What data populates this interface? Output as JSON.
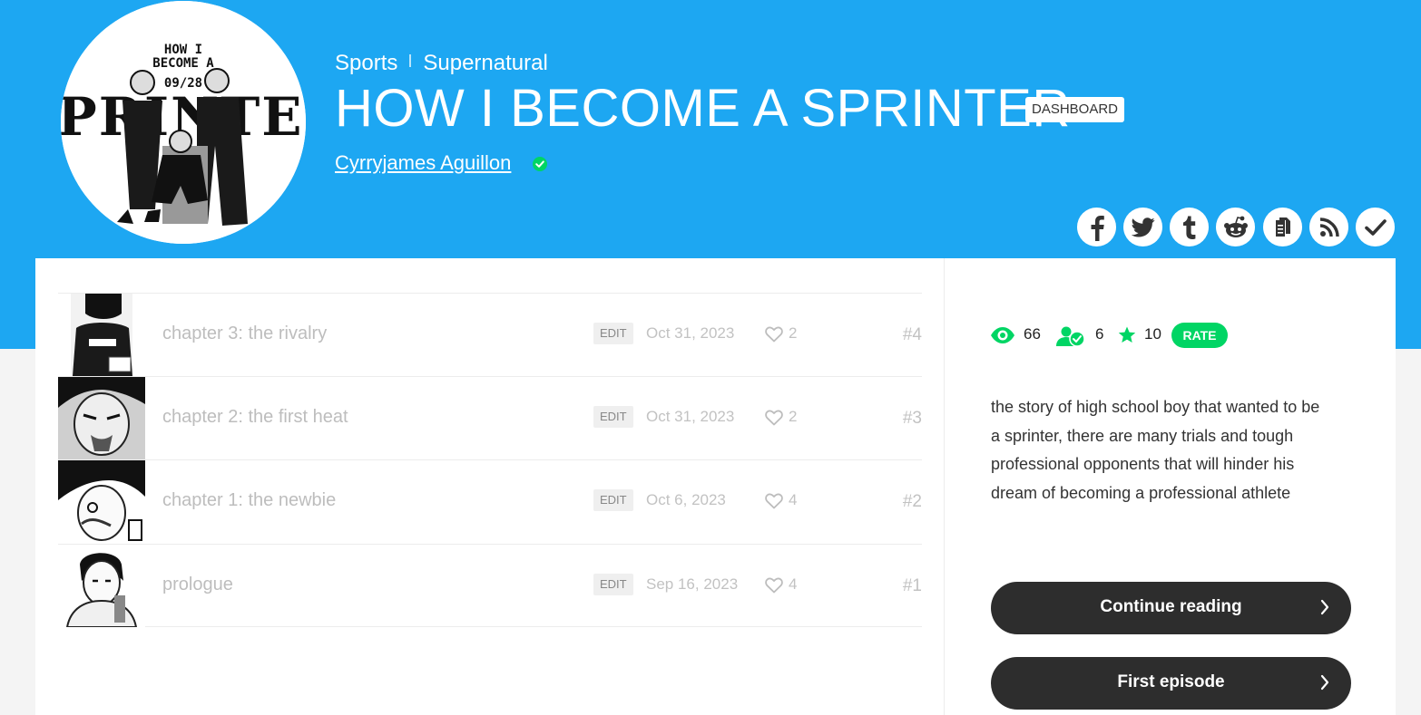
{
  "series": {
    "genres": [
      "Sports",
      "Supernatural"
    ],
    "title": "HOW I BECOME A SPRINTER",
    "dashboard_badge": "DASHBOARD",
    "author": "Cyrryjames Aguillon"
  },
  "share_buttons": [
    "facebook-icon",
    "twitter-icon",
    "tumblr-icon",
    "reddit-icon",
    "copy-icon",
    "rss-icon",
    "check-icon"
  ],
  "episodes": [
    {
      "title": "chapter 3: the rivalry",
      "edit": "EDIT",
      "date": "Oct 31, 2023",
      "likes": "2",
      "number": "#4"
    },
    {
      "title": "chapter 2: the first heat",
      "edit": "EDIT",
      "date": "Oct 31, 2023",
      "likes": "2",
      "number": "#3"
    },
    {
      "title": "chapter 1: the newbie",
      "edit": "EDIT",
      "date": "Oct 6, 2023",
      "likes": "4",
      "number": "#2"
    },
    {
      "title": "prologue",
      "edit": "EDIT",
      "date": "Sep 16, 2023",
      "likes": "4",
      "number": "#1"
    }
  ],
  "stats": {
    "views": "66",
    "subscribers": "6",
    "rating": "10",
    "rate_label": "RATE"
  },
  "description": "the story of high school boy that wanted to be a sprinter, there are many trials and tough professional opponents that will hinder his dream of becoming a professional athlete",
  "actions": {
    "continue_label": "Continue reading",
    "first_label": "First episode"
  },
  "colors": {
    "header_blue": "#1da7f2",
    "accent_green": "#00d564",
    "button_dark": "#2d2d2d"
  }
}
